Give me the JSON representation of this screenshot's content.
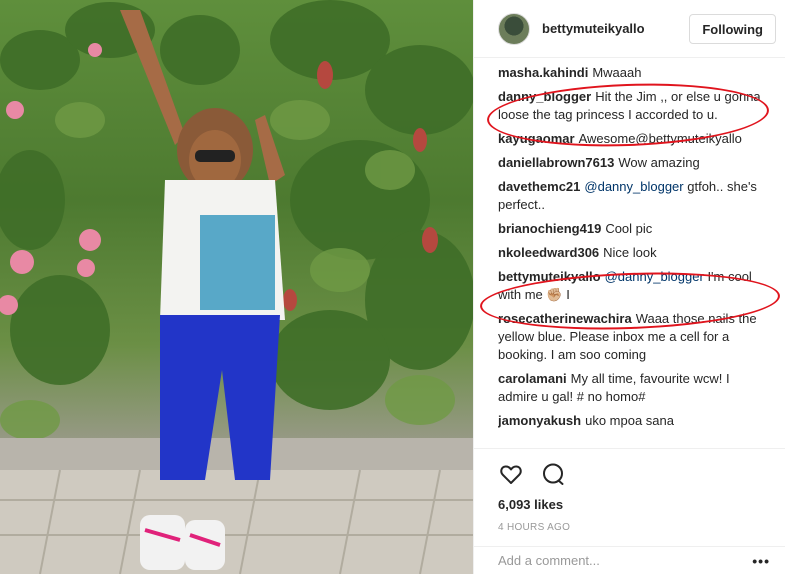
{
  "post": {
    "username": "bettymuteikyallo",
    "follow_label": "Following"
  },
  "comments": [
    {
      "author": "masha.kahindi",
      "mention": "",
      "text": "Mwaaah"
    },
    {
      "author": "danny_blogger",
      "mention": "",
      "text": "Hit the Jim ,, or else u gonna loose the tag princess I accorded to u."
    },
    {
      "author": "kayugaomar",
      "mention": "",
      "text": "Awesome@bettymuteikyallo"
    },
    {
      "author": "daniellabrown7613",
      "mention": "",
      "text": "Wow amazing"
    },
    {
      "author": "davethemc21",
      "mention": "@danny_blogger",
      "text": "gtfoh.. she's perfect.."
    },
    {
      "author": "brianochieng419",
      "mention": "",
      "text": "Cool pic"
    },
    {
      "author": "nkoleedward306",
      "mention": "",
      "text": "Nice look"
    },
    {
      "author": "bettymuteikyallo",
      "mention": "@danny_blogger",
      "text": "I'm cool with me ✊🏼 I"
    },
    {
      "author": "rosecatherinewachira",
      "mention": "",
      "text": "Waaa those nails the yellow blue. Please inbox me a cell for a booking. I am soo coming"
    },
    {
      "author": "carolamani",
      "mention": "",
      "text": "My all time, favourite wcw! I admire u gal! # no homo#"
    },
    {
      "author": "jamonyakush",
      "mention": "",
      "text": "uko mpoa sana"
    }
  ],
  "actions": {
    "like_icon": "heart-icon",
    "comment_icon": "comment-bubble-icon",
    "likes": "6,093 likes",
    "time": "4 HOURS AGO"
  },
  "add_comment": {
    "placeholder": "Add a comment...",
    "more": "•••"
  },
  "colors": {
    "annotation": "#e0141d",
    "mention": "#003569"
  }
}
